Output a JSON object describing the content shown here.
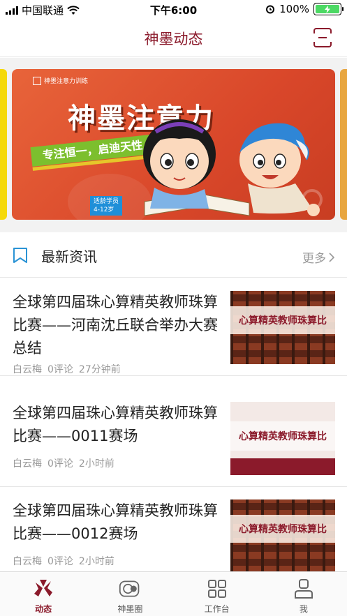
{
  "status_bar": {
    "carrier": "中国联通",
    "time": "下午6:00",
    "battery": "100%"
  },
  "nav": {
    "title": "神墨动态"
  },
  "banner": {
    "logo_text": "神墨注意力训练",
    "headline": "神墨注意力",
    "slogan": "专注恒一，启迪天性",
    "age_label": "适龄学员",
    "age_range": "4-12岁"
  },
  "section": {
    "title": "最新资讯",
    "more": "更多"
  },
  "news": [
    {
      "title": "全球第四届珠心算精英教师珠算比赛——河南沈丘联合举办大赛总结",
      "author": "白云梅",
      "comments": "0评论",
      "time": "27分钟前",
      "thumb_text": "心算精英教师珠算比"
    },
    {
      "title": "全球第四届珠心算精英教师珠算比赛——0011赛场",
      "author": "白云梅",
      "comments": "0评论",
      "time": "2小时前",
      "thumb_text": "心算精英教师珠算比"
    },
    {
      "title": "全球第四届珠心算精英教师珠算比赛——0012赛场",
      "author": "白云梅",
      "comments": "0评论",
      "time": "2小时前",
      "thumb_text": "心算精英教师珠算比"
    }
  ],
  "tabs": [
    {
      "label": "动态",
      "icon": "dynamics-icon",
      "active": true
    },
    {
      "label": "神墨圈",
      "icon": "circle-icon",
      "active": false
    },
    {
      "label": "工作台",
      "icon": "grid-icon",
      "active": false
    },
    {
      "label": "我",
      "icon": "user-icon",
      "active": false
    }
  ],
  "colors": {
    "brand": "#8b1a2b",
    "banner_bg": "#d9472a",
    "accent_green": "#7cbf2e",
    "battery_green": "#4cd964"
  }
}
